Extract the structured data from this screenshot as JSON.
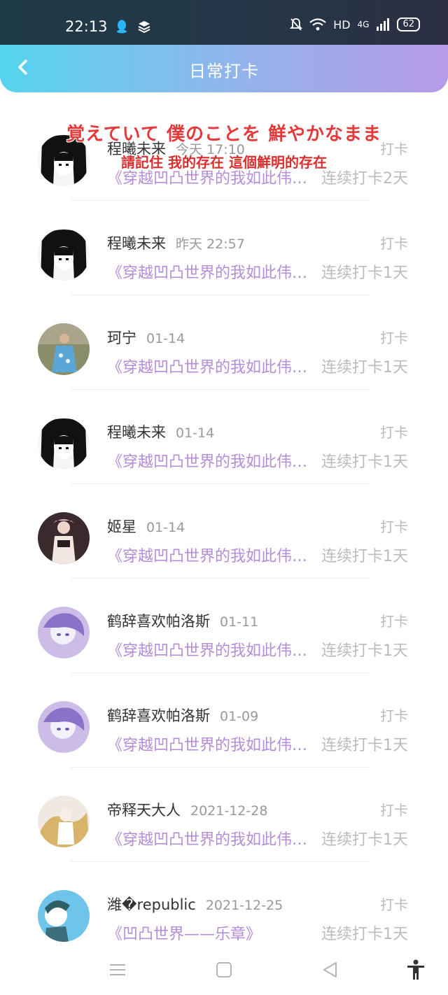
{
  "status_bar": {
    "time": "22:13",
    "network": "HD",
    "signal": "4G",
    "battery": "62"
  },
  "header": {
    "title": "日常打卡"
  },
  "overlay_lyrics": {
    "line1": "覚えていて 僕のことを 鮮やかなまま",
    "line2": "請記住 我的存在 這個鮮明的存在"
  },
  "checkins": [
    {
      "user": "程曦未来",
      "date": "今天 17:10",
      "book": "《穿越凹凸世界的我如此伟…",
      "action": "打卡",
      "streak": "连续打卡2天",
      "avatar": "anime-bw"
    },
    {
      "user": "程曦未来",
      "date": "昨天 22:57",
      "book": "《穿越凹凸世界的我如此伟…",
      "action": "打卡",
      "streak": "连续打卡1天",
      "avatar": "anime-bw"
    },
    {
      "user": "珂宁",
      "date": "01-14",
      "book": "《穿越凹凸世界的我如此伟…",
      "action": "打卡",
      "streak": "连续打卡1天",
      "avatar": "photo-girl"
    },
    {
      "user": "程曦未来",
      "date": "01-14",
      "book": "《穿越凹凸世界的我如此伟…",
      "action": "打卡",
      "streak": "连续打卡1天",
      "avatar": "anime-bw"
    },
    {
      "user": "姬星",
      "date": "01-14",
      "book": "《穿越凹凸世界的我如此伟…",
      "action": "打卡",
      "streak": "连续打卡1天",
      "avatar": "dark-anime"
    },
    {
      "user": "鹤辞喜欢帕洛斯",
      "date": "01-11",
      "book": "《穿越凹凸世界的我如此伟…",
      "action": "打卡",
      "streak": "连续打卡1天",
      "avatar": "purple-anime"
    },
    {
      "user": "鹤辞喜欢帕洛斯",
      "date": "01-09",
      "book": "《穿越凹凸世界的我如此伟…",
      "action": "打卡",
      "streak": "连续打卡1天",
      "avatar": "purple-anime"
    },
    {
      "user": "帝释天大人",
      "date": "2021-12-28",
      "book": "《穿越凹凸世界的我如此伟…",
      "action": "打卡",
      "streak": "连续打卡1天",
      "avatar": "gold-anime"
    },
    {
      "user": "潍�republic",
      "date": "2021-12-25",
      "book": "《凹凸世界——乐章》",
      "action": "打卡",
      "streak": "连续打卡1天",
      "avatar": "blue-anime"
    }
  ],
  "colors": {
    "header_gradient_start": "#55d4ef",
    "header_gradient_end": "#b79be8",
    "book_title": "#b58cd8",
    "lyrics_red": "#e33b3b"
  },
  "nav_icons": [
    "menu-icon",
    "home-square-icon",
    "back-triangle-icon",
    "accessibility-icon"
  ]
}
